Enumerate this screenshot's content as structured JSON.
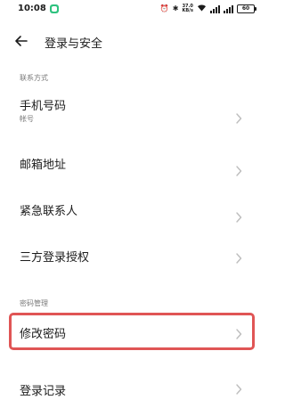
{
  "status_bar": {
    "time": "10:08",
    "network_speed": "37.0",
    "network_unit": "KB/s",
    "battery": "60"
  },
  "header": {
    "title": "登录与安全"
  },
  "sections": {
    "contact": {
      "label": "联系方式",
      "phone": {
        "label": "手机号码",
        "sub": "帐号"
      },
      "email": {
        "label": "邮箱地址"
      },
      "emergency": {
        "label": "紧急联系人"
      },
      "third_party": {
        "label": "三方登录授权"
      }
    },
    "password": {
      "label": "密码管理",
      "change_password": {
        "label": "修改密码"
      },
      "login_records": {
        "label": "登录记录"
      }
    }
  },
  "colors": {
    "highlight": "#e05555",
    "secondary_text": "#7a7a7a",
    "chevron": "#bdbdbd"
  }
}
